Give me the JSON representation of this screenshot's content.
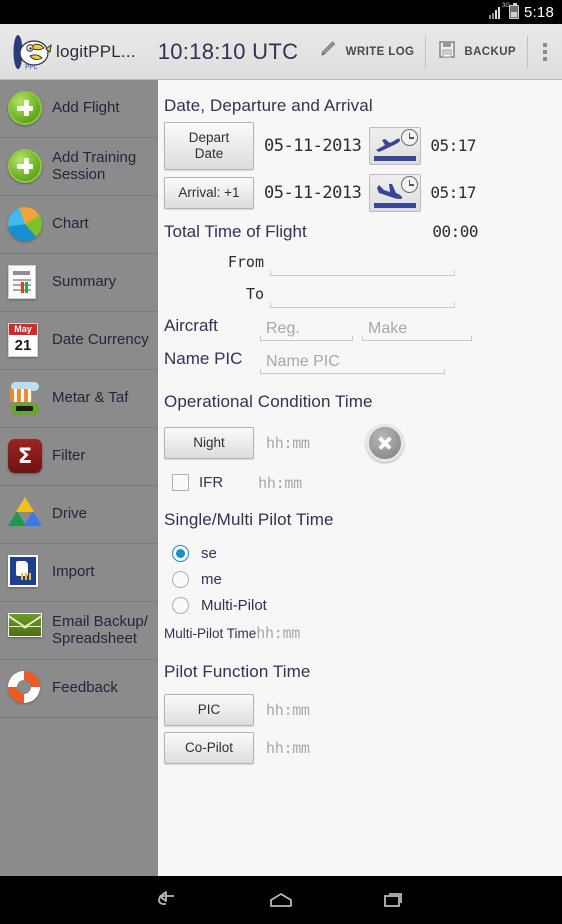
{
  "statusbar": {
    "time": "5:18",
    "network": "3G",
    "signal_icon": "signal-bars-icon",
    "battery_icon": "battery-icon"
  },
  "actionbar": {
    "logo_icon": "app-logo-icon",
    "app_name": "logitPPL...",
    "utc_clock": "10:18:10 UTC",
    "write_log_label": "WRITE LOG",
    "write_log_icon": "pencil-icon",
    "backup_label": "BACKUP",
    "backup_icon": "floppy-disk-icon",
    "overflow_icon": "overflow-menu-icon"
  },
  "sidebar": {
    "items": [
      {
        "label": "Add Flight",
        "icon": "plus-circle-icon"
      },
      {
        "label": "Add Training Session",
        "icon": "plus-circle-icon"
      },
      {
        "label": "Chart",
        "icon": "pie-chart-icon"
      },
      {
        "label": "Summary",
        "icon": "document-icon"
      },
      {
        "label": "Date Currency",
        "icon": "calendar-icon",
        "month": "May",
        "day": "21"
      },
      {
        "label": "Metar & Taf",
        "icon": "windsock-icon"
      },
      {
        "label": "Filter",
        "icon": "sigma-filter-icon"
      },
      {
        "label": "Drive",
        "icon": "google-drive-icon"
      },
      {
        "label": "Import",
        "icon": "import-icon"
      },
      {
        "label": "Email Backup/ Spreadsheet",
        "icon": "envelope-icon"
      },
      {
        "label": "Feedback",
        "icon": "lifering-icon"
      }
    ]
  },
  "main": {
    "section_date": "Date, Departure and Arrival",
    "depart": {
      "button_label": "Depart Date",
      "date": "05-11-2013",
      "time_icon": "plane-takeoff-clock-icon",
      "time": "05:17"
    },
    "arrival": {
      "button_label": "Arrival: +1",
      "date": "05-11-2013",
      "time_icon": "plane-landing-clock-icon",
      "time": "05:17"
    },
    "total_time_label": "Total Time of Flight",
    "total_time_value": "00:00",
    "from_label": "From",
    "from_value": "",
    "to_label": "To",
    "to_value": "",
    "aircraft_label": "Aircraft",
    "aircraft_reg_placeholder": "Reg.",
    "aircraft_make_placeholder": "Make",
    "name_pic_label": "Name PIC",
    "name_pic_placeholder": "Name PIC",
    "section_ops": "Operational Condition Time",
    "night_button": "Night",
    "night_placeholder": "hh:mm",
    "clear_icon": "clear-circle-x-icon",
    "ifr_label": "IFR",
    "ifr_placeholder": "hh:mm",
    "ifr_checked": false,
    "section_pilot": "Single/Multi Pilot Time",
    "radios": [
      {
        "label": "se",
        "selected": true
      },
      {
        "label": "me",
        "selected": false
      },
      {
        "label": "Multi-Pilot",
        "selected": false
      }
    ],
    "multi_pilot_time_label": "Multi-Pilot Time",
    "multi_pilot_time_placeholder": "hh:mm",
    "section_function": "Pilot Function Time",
    "pic_button": "PIC",
    "pic_placeholder": "hh:mm",
    "copilot_button": "Co-Pilot",
    "copilot_placeholder": "hh:mm"
  },
  "navbar": {
    "back_icon": "back-icon",
    "home_icon": "home-icon",
    "recents_icon": "recents-icon"
  },
  "colors": {
    "accent": "#2f3354",
    "sidebar": "#8b8b8b",
    "radio_on": "#1a8fc1",
    "plane": "#3b4595"
  }
}
